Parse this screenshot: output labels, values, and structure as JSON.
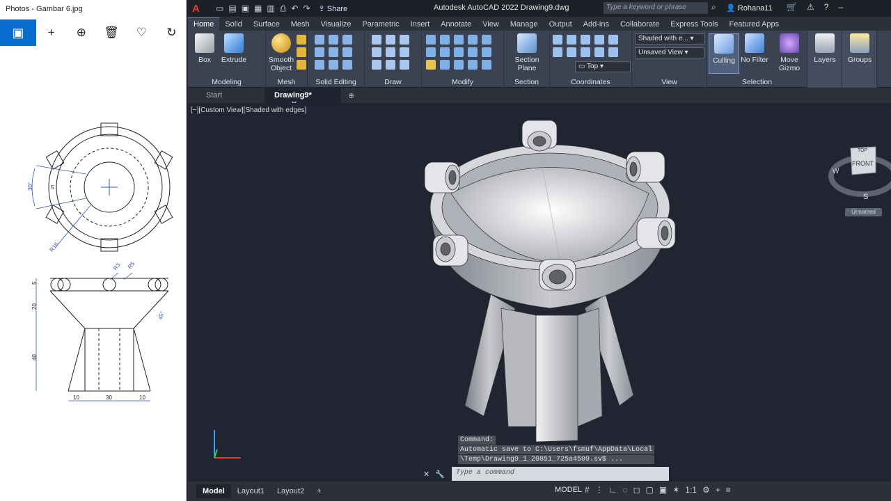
{
  "photos": {
    "title": "Photos - Gambar 6.jpg",
    "tools": [
      "add-icon",
      "zoom-icon",
      "delete-icon",
      "favorite-icon",
      "rotate-icon"
    ],
    "drawing_dims": {
      "top_angle": "30°",
      "top_five": "5",
      "radius": "R15",
      "r3": "R3",
      "r5": "R5",
      "side_5": "5",
      "side_20": "20",
      "side_40": "40",
      "angle45": "45°",
      "bottom_10a": "10",
      "bottom_30": "30",
      "bottom_10b": "10"
    }
  },
  "acad": {
    "title": "Autodesk AutoCAD 2022    Drawing9.dwg",
    "share": "Share",
    "search_placeholder": "Type a keyword or phrase",
    "user": "Rohana11",
    "tabs": [
      "Home",
      "Solid",
      "Surface",
      "Mesh",
      "Visualize",
      "Parametric",
      "Insert",
      "Annotate",
      "View",
      "Manage",
      "Output",
      "Add-ins",
      "Collaborate",
      "Express Tools",
      "Featured Apps"
    ],
    "ribbon": {
      "box": "Box",
      "extrude": "Extrude",
      "smooth1": "Smooth",
      "smooth2": "Object",
      "section1": "Section",
      "section2": "Plane",
      "culling": "Culling",
      "nofilter": "No Filter",
      "move1": "Move",
      "move2": "Gizmo",
      "layers": "Layers",
      "groups": "Groups",
      "visual_style": "Shaded with e...",
      "named_view": "Unsaved View",
      "ucs_view": "Top",
      "panels": {
        "modeling": "Modeling",
        "mesh": "Mesh",
        "solid_editing": "Solid Editing",
        "draw": "Draw",
        "modify": "Modify",
        "section": "Section",
        "coordinates": "Coordinates",
        "view": "View",
        "selection": "Selection"
      }
    },
    "file_tabs": {
      "start": "Start",
      "drawing": "Drawing9*"
    },
    "viewport_label": "[−][Custom View][Shaded with edges]",
    "viewcube": {
      "top": "TOP",
      "front": "FRONT",
      "w": "W",
      "s": "S",
      "unnamed": "Unnamed"
    },
    "command": {
      "history1": "Command:",
      "history2": "Automatic save to C:\\Users\\fsmuf\\AppData\\Local",
      "history3": "\\Temp\\Drawing9_1_20851_725a4509.sv$ ...",
      "placeholder": "Type a command"
    },
    "layout_tabs": [
      "Model",
      "Layout1",
      "Layout2"
    ],
    "status": {
      "model": "MODEL",
      "scale": "1:1"
    }
  }
}
